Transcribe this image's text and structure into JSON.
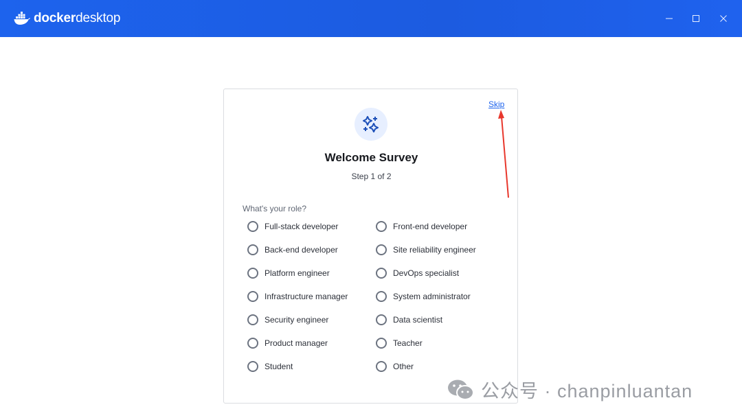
{
  "app": {
    "title_part1": "docker",
    "title_part2": "desktop",
    "colors": {
      "titlebar": "#1d63ed",
      "accent": "#1d63ed"
    }
  },
  "window_controls": {
    "minimize_icon": "minimize-icon",
    "maximize_icon": "maximize-icon",
    "close_icon": "close-icon"
  },
  "survey": {
    "skip_label": "Skip",
    "icon": "sparkles-icon",
    "title": "Welcome Survey",
    "step": "Step 1 of 2",
    "question": "What's your role?",
    "options_left": [
      "Full-stack developer",
      "Back-end developer",
      "Platform engineer",
      "Infrastructure manager",
      "Security engineer",
      "Product manager",
      "Student"
    ],
    "options_right": [
      "Front-end developer",
      "Site reliability engineer",
      "DevOps specialist",
      "System administrator",
      "Data scientist",
      "Teacher",
      "Other"
    ]
  },
  "annotation": {
    "arrow_color": "#e8372c"
  },
  "watermark": {
    "text": "公众号 · chanpinluantan"
  }
}
